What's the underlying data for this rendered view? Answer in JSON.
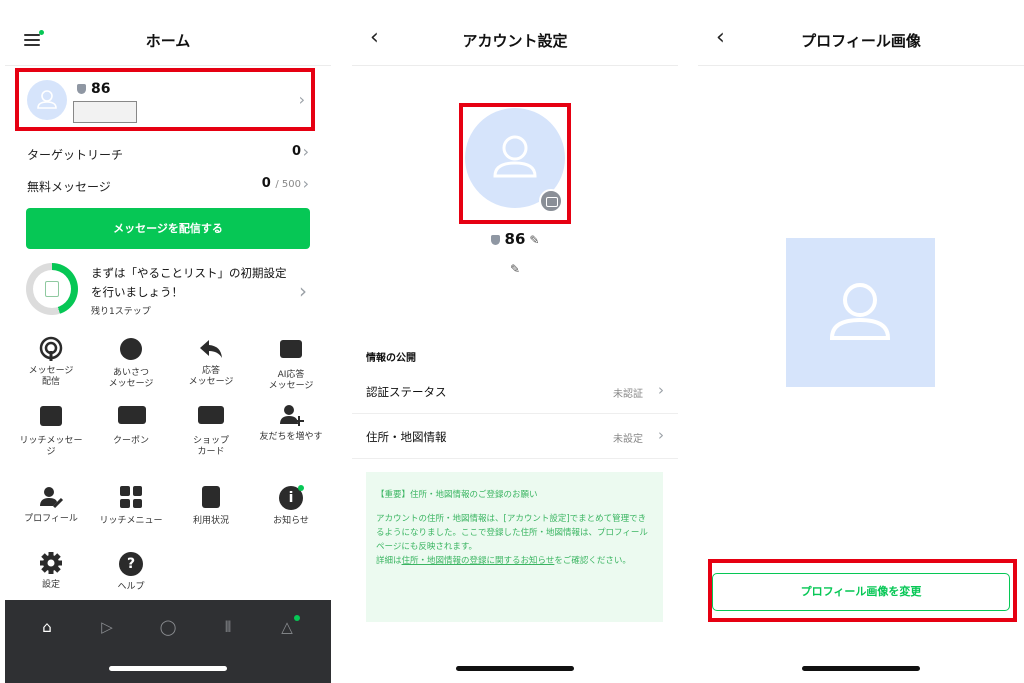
{
  "home": {
    "title": "ホーム",
    "account": {
      "follower_count": "86"
    },
    "target_reach": {
      "label": "ターゲットリーチ",
      "value": "0"
    },
    "free_messages": {
      "label": "無料メッセージ",
      "value": "0",
      "limit": "/ 500"
    },
    "cta_label": "メッセージを配信する",
    "todo": {
      "text": "まずは「やることリスト」の初期設定を行いましょう！",
      "sub": "残り1ステップ",
      "progress_fraction": 0.45
    },
    "menu": [
      {
        "label": "メッセージ\n配信",
        "icon": "broadcast-icon"
      },
      {
        "label": "あいさつ\nメッセージ",
        "icon": "greeting-icon"
      },
      {
        "label": "応答\nメッセージ",
        "icon": "reply-icon"
      },
      {
        "label": "AI応答\nメッセージ",
        "icon": "robot-icon"
      },
      {
        "label": "リッチメッセー\nジ",
        "icon": "rich-message-icon"
      },
      {
        "label": "クーポン",
        "icon": "coupon-icon"
      },
      {
        "label": "ショップ\nカード",
        "icon": "shop-card-icon"
      },
      {
        "label": "友だちを増やす",
        "icon": "add-friend-icon"
      },
      {
        "label": "プロフィール",
        "icon": "profile-icon"
      },
      {
        "label": "リッチメニュー",
        "icon": "rich-menu-icon"
      },
      {
        "label": "利用状況",
        "icon": "usage-icon"
      },
      {
        "label": "お知らせ",
        "icon": "info-icon"
      },
      {
        "label": "設定",
        "icon": "settings-icon"
      },
      {
        "label": "ヘルプ",
        "icon": "help-icon"
      }
    ],
    "tabs": [
      "home-icon",
      "play-icon",
      "chat-icon",
      "chart-icon",
      "bell-icon"
    ]
  },
  "account_settings": {
    "title": "アカウント設定",
    "follower_count": "86",
    "section_title": "情報の公開",
    "rows": [
      {
        "label": "認証ステータス",
        "value": "未認証"
      },
      {
        "label": "住所・地図情報",
        "value": "未設定"
      }
    ],
    "notice": {
      "heading": "【重要】住所・地図情報のご登録のお願い",
      "body": "アカウントの住所・地図情報は、[アカウント設定]でまとめて管理できるようになりました。ここで登録した住所・地図情報は、プロフィールページにも反映されます。",
      "detail_prefix": "詳細は",
      "detail_link": "住所・地図情報の登録に関するお知らせ",
      "detail_suffix": "をご確認ください。"
    }
  },
  "profile_image": {
    "title": "プロフィール画像",
    "change_button": "プロフィール画像を変更"
  },
  "colors": {
    "brand_green": "#06c755",
    "highlight_red": "#e60012",
    "avatar_bg": "#d6e4fb",
    "tabbar_bg": "#2f3033"
  }
}
